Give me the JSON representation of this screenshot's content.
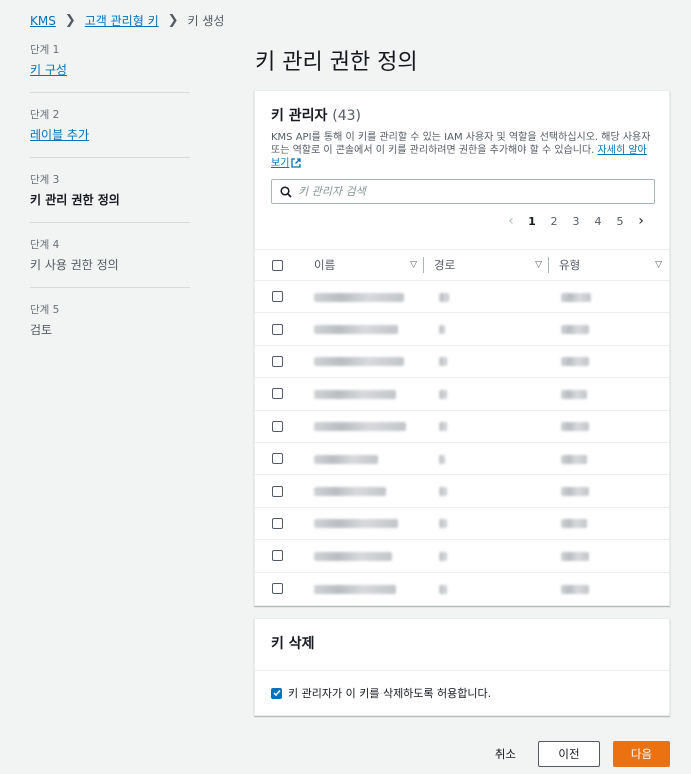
{
  "breadcrumb": {
    "items": [
      "KMS",
      "고객 관리형 키"
    ],
    "current": "키 생성"
  },
  "steps": [
    {
      "num": "단계 1",
      "title": "키 구성",
      "state": "link"
    },
    {
      "num": "단계 2",
      "title": "레이블 추가",
      "state": "link"
    },
    {
      "num": "단계 3",
      "title": "키 관리 권한 정의",
      "state": "active"
    },
    {
      "num": "단계 4",
      "title": "키 사용 권한 정의",
      "state": "disabled"
    },
    {
      "num": "단계 5",
      "title": "검토",
      "state": "disabled"
    }
  ],
  "page_title": "키 관리 권한 정의",
  "admins": {
    "title": "키 관리자",
    "count": "(43)",
    "description": "KMS API를 통해 이 키를 관리할 수 있는 IAM 사용자 및 역할을 선택하십시오. 해당 사용자 또는 역할로 이 콘솔에서 이 키를 관리하려면 권한을 추가해야 할 수 있습니다.",
    "learn_more": "자세히 알아보기",
    "search_placeholder": "키 관리자 검색",
    "pages": [
      "1",
      "2",
      "3",
      "4",
      "5"
    ],
    "current_page": "1",
    "columns": {
      "name": "이름",
      "path": "경로",
      "type": "유형"
    },
    "row_count": 10
  },
  "delete_section": {
    "title": "키 삭제",
    "checkbox_label": "키 관리자가 이 키를 삭제하도록 허용합니다.",
    "checked": true
  },
  "footer": {
    "cancel": "취소",
    "previous": "이전",
    "next": "다음"
  },
  "colors": {
    "link": "#0073bb",
    "primary": "#ec7211",
    "background": "#f2f3f3"
  }
}
